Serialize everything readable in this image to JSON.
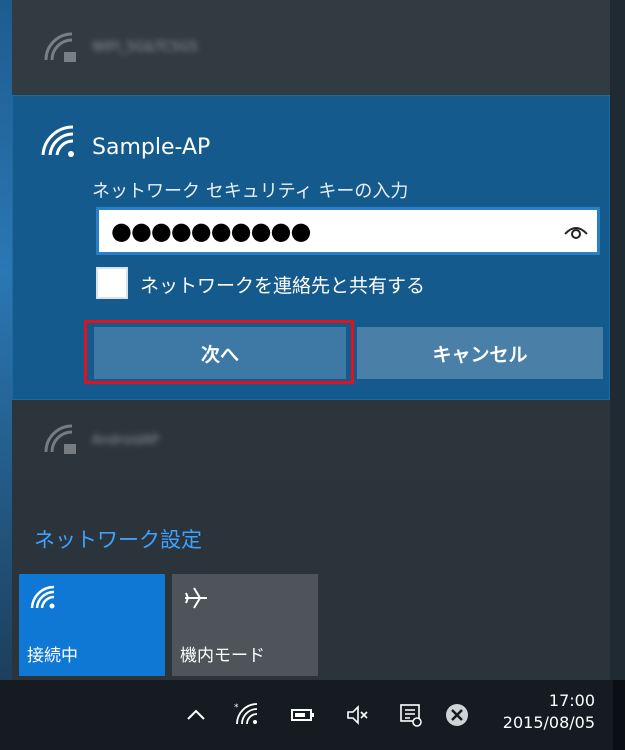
{
  "other_networks": {
    "top_ssid": "WIFI_5G&TC5G5",
    "bottom_ssid": "AndroidAP"
  },
  "connect_panel": {
    "ap_name": "Sample-AP",
    "key_label": "ネットワーク セキュリティ キーの入力",
    "password_value": "●●●●●●●●●●",
    "share_label": "ネットワークを連絡先と共有する",
    "next_label": "次へ",
    "cancel_label": "キャンセル"
  },
  "network_settings_label": "ネットワーク設定",
  "quick_actions": {
    "wifi_label": "接続中",
    "airplane_label": "機内モード"
  },
  "taskbar": {
    "time": "17:00",
    "date": "2015/08/05"
  },
  "colors": {
    "accent": "#0f78d4",
    "panel": "#155a8c",
    "focus": "#e0121d",
    "link": "#3da1ff"
  }
}
